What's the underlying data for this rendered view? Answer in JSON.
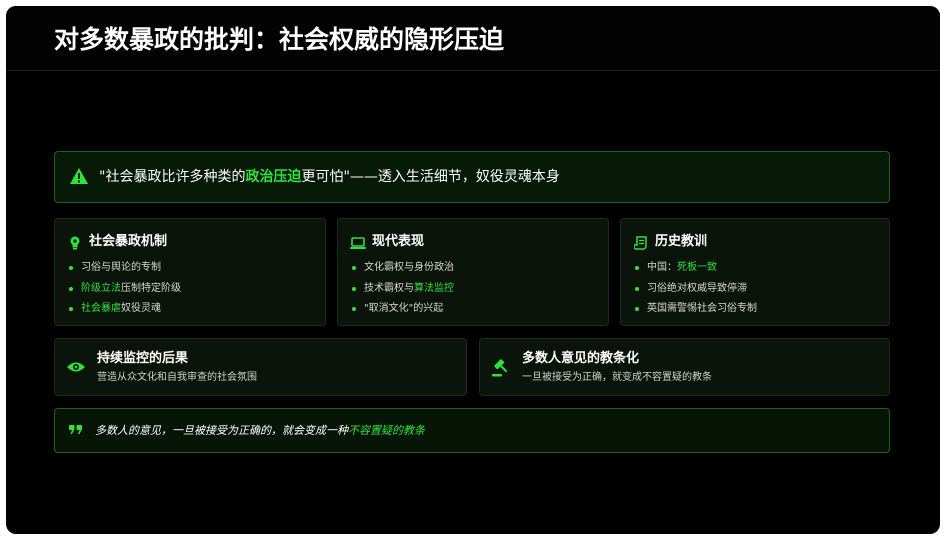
{
  "title": "对多数暴政的批判：社会权威的隐形压迫",
  "alert": {
    "icon": "warning-triangle-icon",
    "text_before": "\"社会暴政比许多种类的",
    "highlight": "政治压迫",
    "text_after": "更可怕\"——透入生活细节，奴役灵魂本身"
  },
  "cards": [
    {
      "title": "社会暴政机制",
      "icon": "lightbulb-icon",
      "items": [
        {
          "before": "习俗与舆论的专制",
          "hl": "",
          "after": ""
        },
        {
          "before": "",
          "hl": "阶级立法",
          "after": "压制特定阶级"
        },
        {
          "before": "",
          "hl": "社会暴虐",
          "after": "奴役灵魂"
        }
      ]
    },
    {
      "title": "现代表现",
      "icon": "laptop-icon",
      "items": [
        {
          "before": "文化霸权与身份政治",
          "hl": "",
          "after": ""
        },
        {
          "before": "技术霸权与",
          "hl": "算法监控",
          "after": ""
        },
        {
          "before": "\"取消文化\"的兴起",
          "hl": "",
          "after": ""
        }
      ]
    },
    {
      "title": "历史教训",
      "icon": "scroll-icon",
      "items": [
        {
          "before": "中国：",
          "hl": "死板一致",
          "after": ""
        },
        {
          "before": "习俗绝对权威导致停滞",
          "hl": "",
          "after": ""
        },
        {
          "before": "英国需警惕社会习俗专制",
          "hl": "",
          "after": ""
        }
      ]
    }
  ],
  "bottom_cards": [
    {
      "title": "持续监控的后果",
      "desc": "营造从众文化和自我审查的社会氛围",
      "icon": "eye-icon"
    },
    {
      "title": "多数人意见的教条化",
      "desc": "一旦被接受为正确，就变成不容置疑的教条",
      "icon": "gavel-icon"
    }
  ],
  "quote": {
    "icon": "quote-icon",
    "text_before": "多数人的意见，一旦被接受为正确的，就会变成一种",
    "highlight": "不容置疑的教条"
  },
  "colors": {
    "accent": "#2ee23b",
    "background": "#000000",
    "card": "#0a140a",
    "border": "#1f5f1f"
  }
}
